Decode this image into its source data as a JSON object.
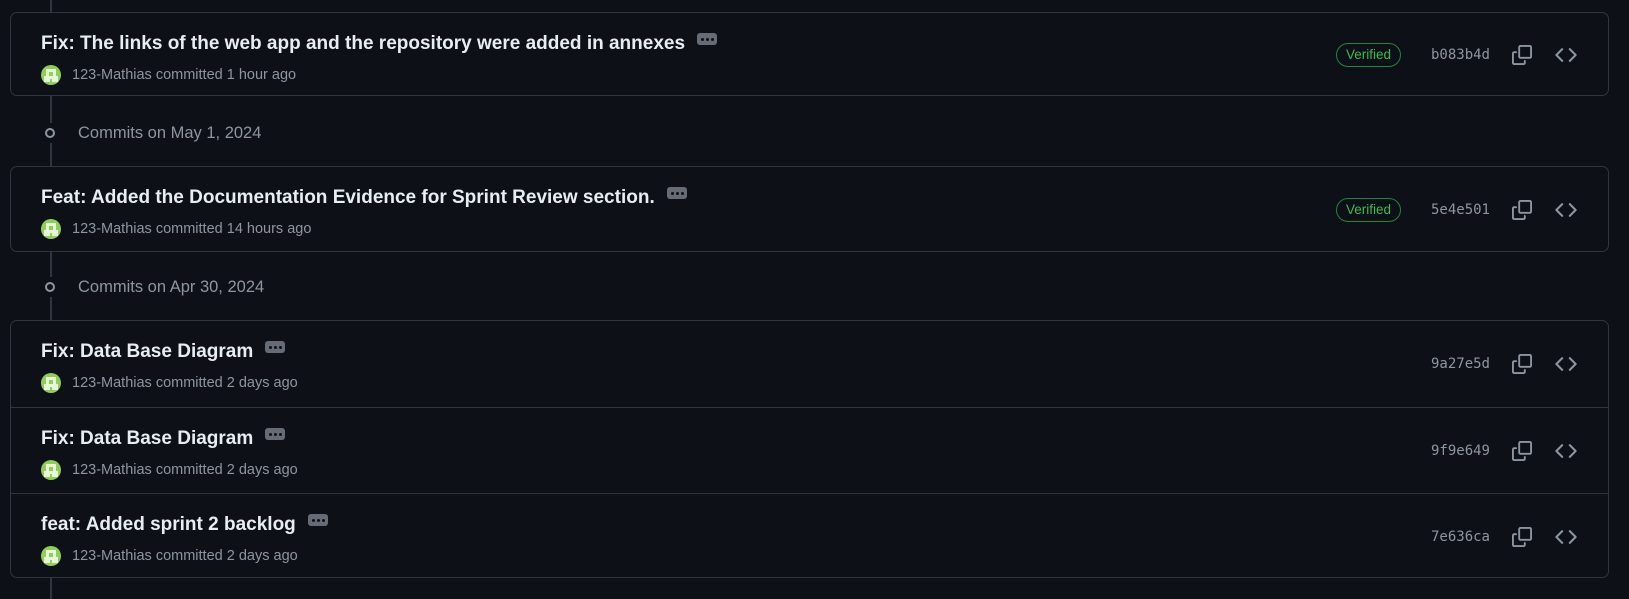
{
  "groups": [
    {
      "date_label": "",
      "commits": [
        {
          "title": "Fix: The links of the web app and the repository were added in annexes",
          "author": "123-Mathias",
          "action": "committed",
          "time": "1 hour ago",
          "verified": "Verified",
          "sha": "b083b4d"
        }
      ]
    },
    {
      "date_label": "Commits on May 1, 2024",
      "commits": [
        {
          "title": "Feat: Added the Documentation Evidence for Sprint Review section.",
          "author": "123-Mathias",
          "action": "committed",
          "time": "14 hours ago",
          "verified": "Verified",
          "sha": "5e4e501"
        }
      ]
    },
    {
      "date_label": "Commits on Apr 30, 2024",
      "commits": [
        {
          "title": "Fix: Data Base Diagram",
          "author": "123-Mathias",
          "action": "committed",
          "time": "2 days ago",
          "verified": "",
          "sha": "9a27e5d"
        },
        {
          "title": "Fix: Data Base Diagram",
          "author": "123-Mathias",
          "action": "committed",
          "time": "2 days ago",
          "verified": "",
          "sha": "9f9e649"
        },
        {
          "title": "feat: Added sprint 2 backlog",
          "author": "123-Mathias",
          "action": "committed",
          "time": "2 days ago",
          "verified": "",
          "sha": "7e636ca"
        }
      ]
    }
  ],
  "icons": {
    "copy": "copy-icon",
    "browse": "code-icon",
    "more": "kebab-horizontal-icon",
    "timeline": "git-commit-icon"
  },
  "colors": {
    "background": "#0d1117",
    "border": "#30363d",
    "text_primary": "#e6edf3",
    "text_muted": "#8d96a0",
    "verified_green": "#3fb950"
  }
}
